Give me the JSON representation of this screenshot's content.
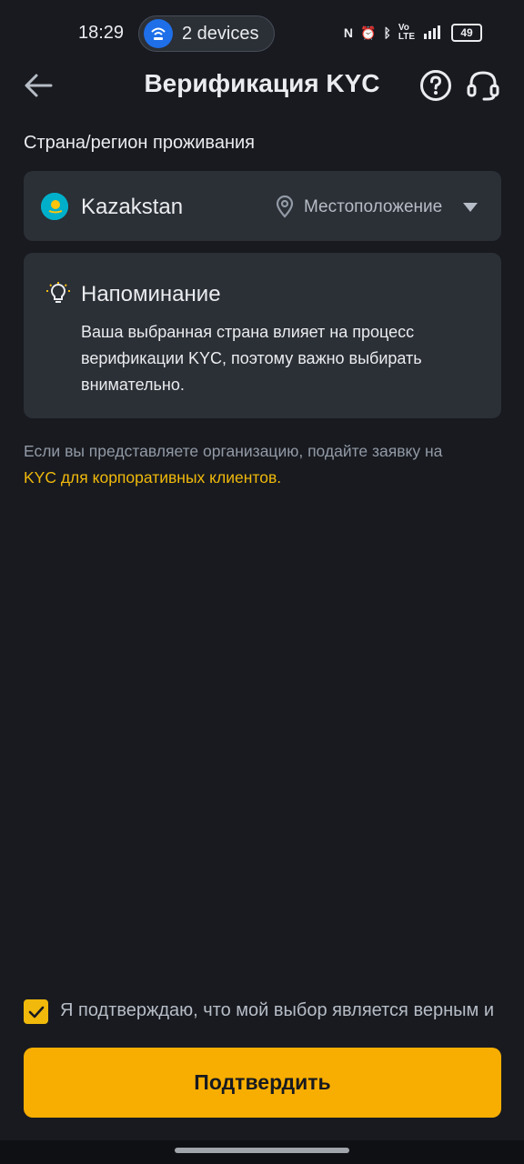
{
  "status_bar": {
    "time": "18:29",
    "devices_label": "2 devices",
    "icons": [
      "nfc-icon",
      "alarm-icon",
      "bluetooth-icon",
      "volte-icon",
      "signal-4g-icon"
    ],
    "battery": "49"
  },
  "header": {
    "title": "Верификация KYC",
    "back_icon": "arrow-left-icon",
    "help_icon": "question-circle-icon",
    "support_icon": "headset-icon"
  },
  "residence": {
    "label": "Страна/регион проживания",
    "country": "Kazakstan",
    "flag_icon": "kazakhstan-flag-icon",
    "location_label": "Местоположение"
  },
  "reminder": {
    "title": "Напоминание",
    "body": "Ваша выбранная страна влияет на процесс верификации KYC, поэтому важно выбирать внимательно."
  },
  "org_note": {
    "text": "Если вы представляете организацию, подайте заявку на",
    "link": "KYC для корпоративных клиентов."
  },
  "confirm": {
    "checked": true,
    "text": "Я подтверждаю, что мой выбор является верным и"
  },
  "submit": {
    "label": "Подтвердить"
  },
  "colors": {
    "background": "#181a20",
    "card": "#2b2f36",
    "accent": "#f0b90b",
    "button": "#f8ae00",
    "muted_text": "#929aa5"
  }
}
